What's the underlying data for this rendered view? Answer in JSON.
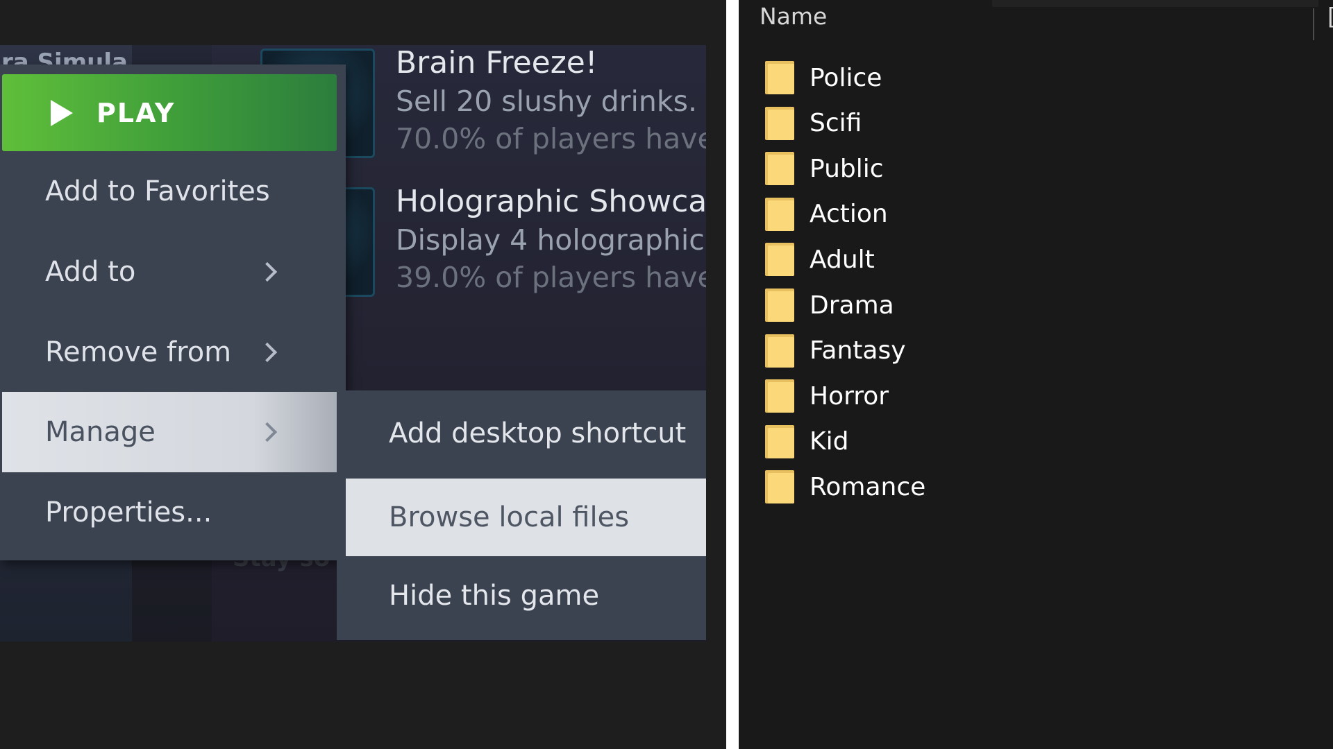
{
  "steam": {
    "ghost_top": "ra Simula",
    "ghost_bottom": "Stay so",
    "achievements": [
      {
        "title": "Brain Freeze!",
        "description": "Sell 20 slushy drinks.",
        "percent": "70.0% of players have"
      },
      {
        "title": "Holographic Showca",
        "description": "Display 4 holographic",
        "percent": "39.0% of players have"
      }
    ],
    "context_menu": {
      "play_label": "PLAY",
      "add_to_favorites": "Add to Favorites",
      "add_to": "Add to",
      "remove_from": "Remove from",
      "manage": "Manage",
      "properties": "Properties..."
    },
    "manage_submenu": {
      "add_desktop_shortcut": "Add desktop shortcut",
      "browse_local_files": "Browse local files",
      "hide_this_game": "Hide this game"
    }
  },
  "explorer": {
    "column_header": "Name",
    "next_header_fragment": "[",
    "folders": [
      {
        "name": "Police",
        "trail": "4"
      },
      {
        "name": "Scifi",
        "trail": "3"
      },
      {
        "name": "Public",
        "trail": "3"
      },
      {
        "name": "Action",
        "trail": "3"
      },
      {
        "name": "Adult",
        "trail": "3"
      },
      {
        "name": "Drama",
        "trail": "3"
      },
      {
        "name": "Fantasy",
        "trail": "3"
      },
      {
        "name": "Horror",
        "trail": "3"
      },
      {
        "name": "Kid",
        "trail": "3"
      },
      {
        "name": "Romance",
        "trail": "3"
      }
    ]
  },
  "colors": {
    "play_green": "#5fbf3a",
    "menu_bg": "#3b4250",
    "highlight": "#dee1e6",
    "folder_yellow": "#fbd97a"
  }
}
